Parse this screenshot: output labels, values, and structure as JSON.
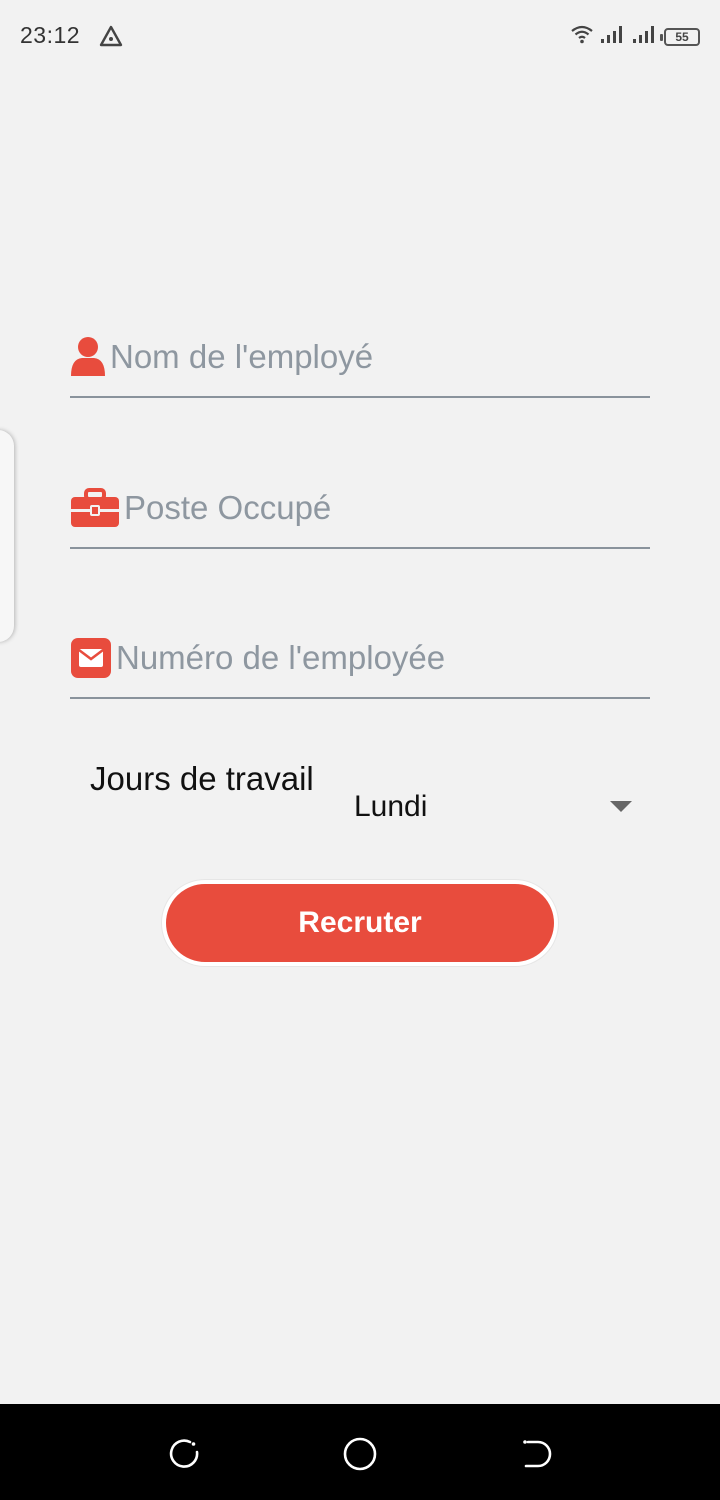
{
  "status_bar": {
    "time": "23:12",
    "battery": "55"
  },
  "form": {
    "name_placeholder": "Nom de l'employé",
    "post_placeholder": "Poste Occupé",
    "number_placeholder": "Numéro de l'employée",
    "days_label": "Jours de travail",
    "days_selected": "Lundi",
    "submit_label": "Recruter"
  },
  "icons": {
    "name": "person-icon",
    "post": "briefcase-icon",
    "number": "envelope-icon",
    "dropdown": "dropdown-arrow-icon"
  },
  "colors": {
    "accent": "#e84c3d",
    "underline": "#8a939c",
    "placeholder": "#8e97a0",
    "background": "#f2f2f2"
  }
}
